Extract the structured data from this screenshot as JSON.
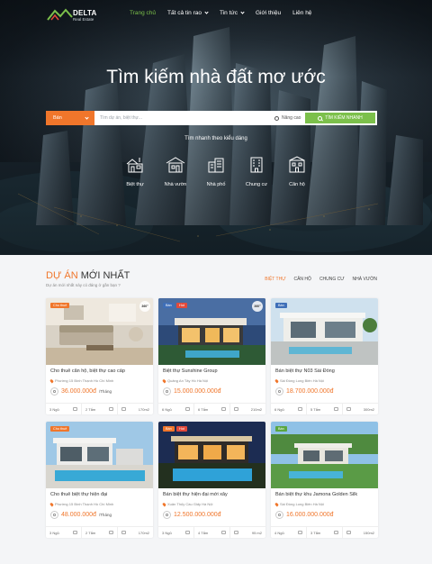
{
  "nav": {
    "logo_text": "DELTA",
    "logo_sub": "Real Estate",
    "items": [
      {
        "label": "Trang chủ",
        "active": true,
        "dropdown": false
      },
      {
        "label": "Tất cả tin rao",
        "active": false,
        "dropdown": true
      },
      {
        "label": "Tin tức",
        "active": false,
        "dropdown": true
      },
      {
        "label": "Giới thiệu",
        "active": false,
        "dropdown": false
      },
      {
        "label": "Liên hệ",
        "active": false,
        "dropdown": false
      }
    ]
  },
  "hero": {
    "title": "Tìm kiếm nhà đất mơ ước",
    "search": {
      "type_value": "Bán",
      "placeholder": "Tìm dự án, biệt thự...",
      "advanced_label": "Nâng cao",
      "button_label": "TÌM KIẾM NHANH"
    },
    "quick_title": "Tìm nhanh theo kiểu dáng",
    "quick_items": [
      {
        "label": "Biệt thự",
        "icon": "villa-icon"
      },
      {
        "label": "Nhà vườn",
        "icon": "garden-house-icon"
      },
      {
        "label": "Nhà phố",
        "icon": "townhouse-icon"
      },
      {
        "label": "Chung cư",
        "icon": "apartment-icon"
      },
      {
        "label": "Căn hộ",
        "icon": "condo-icon"
      }
    ]
  },
  "section": {
    "title_highlight": "DỰ ÁN",
    "title_rest": "MỚI NHẤT",
    "subtitle": "Dự án mới nhất này có đáng ở gần bạn ?",
    "tabs": [
      {
        "label": "BIỆT THỰ",
        "active": true
      },
      {
        "label": "CĂN HỘ",
        "active": false
      },
      {
        "label": "CHUNG CƯ",
        "active": false
      },
      {
        "label": "NHÀ VƯỜN",
        "active": false
      }
    ]
  },
  "listings": [
    {
      "title": "Cho thuê căn hộ, biệt thự cao cấp",
      "location": "Phường 15 Bình Thạnh Hồ Chí Minh",
      "price": "36.000.000đ",
      "unit": "/Tháng",
      "beds": "3 Ngủ",
      "baths": "2 Tắm",
      "area": "170m2",
      "badges": [
        "Cho thuê"
      ],
      "pano": "360°"
    },
    {
      "title": "Biệt thự Sunshine Group",
      "location": "Quảng An Tây Hồ Hà Nội",
      "price": "15.000.000.000đ",
      "unit": "",
      "beds": "6 Ngủ",
      "baths": "6 Tắm",
      "area": "210m2",
      "badges": [
        "Bán",
        "Hot"
      ],
      "pano": "360°"
    },
    {
      "title": "Bán biệt thự N03 Sài Đồng",
      "location": "Sài Đồng Long Biên Hà Nội",
      "price": "18.700.000.000đ",
      "unit": "",
      "beds": "6 Ngủ",
      "baths": "5 Tắm",
      "area": "300m2",
      "badges": [
        "Bán"
      ],
      "pano": ""
    },
    {
      "title": "Cho thuê biệt thự hiện đại",
      "location": "Phường 15 Bình Thạnh Hồ Chí Minh",
      "price": "48.000.000đ",
      "unit": "/Tháng",
      "beds": "3 Ngủ",
      "baths": "2 Tắm",
      "area": "170m2",
      "badges": [
        "Cho thuê"
      ],
      "pano": ""
    },
    {
      "title": "Bán biệt thự hiện đại mới xây",
      "location": "Xuân Thủy Cầu Giấy Hà Nội",
      "price": "12.500.000.000đ",
      "unit": "",
      "beds": "3 Ngủ",
      "baths": "4 Tắm",
      "area": "95 m2",
      "badges": [
        "Bán",
        "Hot"
      ],
      "pano": ""
    },
    {
      "title": "Bán biệt thự khu Jamona Golden Silk",
      "location": "Sài Đồng Long Biên Hà Nội",
      "price": "16.000.000.000đ",
      "unit": "",
      "beds": "4 Ngủ",
      "baths": "3 Tắm",
      "area": "150m2",
      "badges": [
        "Bán"
      ],
      "pano": ""
    }
  ],
  "colors": {
    "accent_orange": "#f0762b",
    "accent_green": "#7cc04b",
    "badge_blue": "#3f6fb8",
    "badge_red": "#e24a3b"
  }
}
